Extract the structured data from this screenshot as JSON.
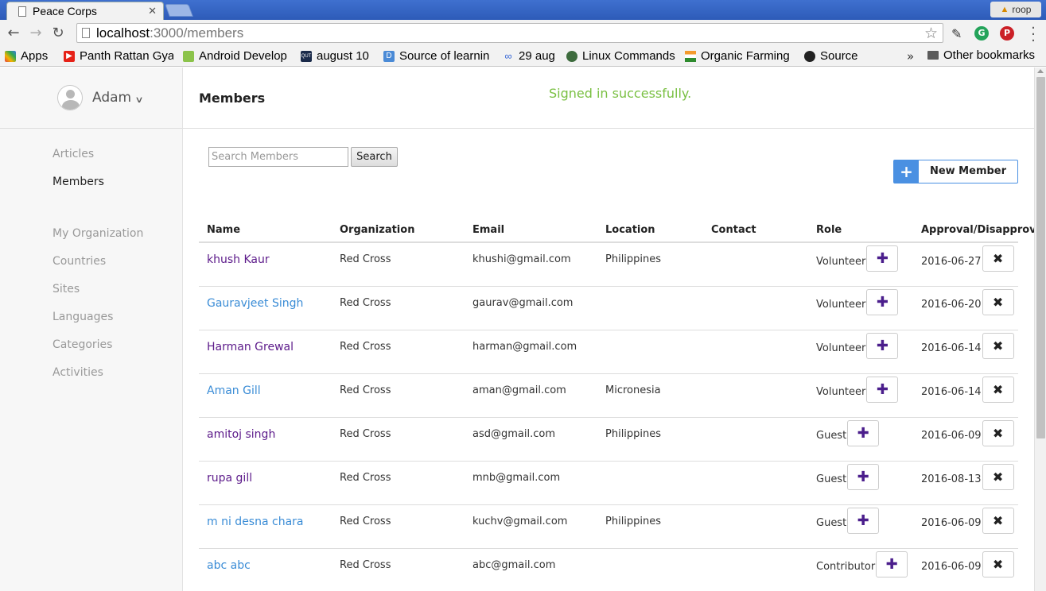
{
  "browser": {
    "tab_title": "Peace Corps",
    "profile_name": "roop",
    "url_host": "localhost",
    "url_path": ":3000/members",
    "bookmarks": [
      {
        "label": "Apps",
        "icon_color": "#e04040"
      },
      {
        "label": "Panth Rattan Gya",
        "icon_color": "#e62117"
      },
      {
        "label": "Android Develop",
        "icon_color": "#8bc34a"
      },
      {
        "label": "august 10",
        "icon_color": "#1a2a4a"
      },
      {
        "label": "Source of learnin",
        "icon_color": "#4a8ad6"
      },
      {
        "label": "29 aug",
        "icon_color": "#3b6ad6"
      },
      {
        "label": "Linux Commands",
        "icon_color": "#3d6b3d"
      },
      {
        "label": "Organic Farming",
        "icon_color": "#f39a2d"
      },
      {
        "label": "Source",
        "icon_color": "#222222"
      }
    ],
    "bookmarks_overflow": "»",
    "other_bookmarks": "Other bookmarks"
  },
  "sidebar": {
    "user_name": "Adam",
    "items": [
      {
        "label": "Articles",
        "active": false
      },
      {
        "label": "Members",
        "active": true
      },
      {
        "label": "My Organization",
        "active": false
      },
      {
        "label": "Countries",
        "active": false
      },
      {
        "label": "Sites",
        "active": false
      },
      {
        "label": "Languages",
        "active": false
      },
      {
        "label": "Categories",
        "active": false
      },
      {
        "label": "Activities",
        "active": false
      }
    ]
  },
  "header": {
    "title": "Members",
    "flash": "Signed in successfully."
  },
  "search": {
    "placeholder": "Search Members",
    "button_label": "Search"
  },
  "new_member": {
    "icon": "+",
    "label": "New Member"
  },
  "table": {
    "columns": [
      "Name",
      "Organization",
      "Email",
      "Location",
      "Contact",
      "Role",
      "Approval/Disapproval"
    ],
    "rows": [
      {
        "name": "khush Kaur",
        "visited": true,
        "organization": "Red Cross",
        "email": "khushi@gmail.com",
        "location": "Philippines",
        "contact": "",
        "role": "Volunteer",
        "date": "2016-06-27"
      },
      {
        "name": "Gauravjeet Singh",
        "visited": false,
        "organization": "Red Cross",
        "email": "gaurav@gmail.com",
        "location": "",
        "contact": "",
        "role": "Volunteer",
        "date": "2016-06-20"
      },
      {
        "name": "Harman Grewal",
        "visited": true,
        "organization": "Red Cross",
        "email": "harman@gmail.com",
        "location": "",
        "contact": "",
        "role": "Volunteer",
        "date": "2016-06-14"
      },
      {
        "name": "Aman Gill",
        "visited": false,
        "organization": "Red Cross",
        "email": "aman@gmail.com",
        "location": "Micronesia",
        "contact": "",
        "role": "Volunteer",
        "date": "2016-06-14"
      },
      {
        "name": "amitoj singh",
        "visited": true,
        "organization": "Red Cross",
        "email": "asd@gmail.com",
        "location": "Philippines",
        "contact": "",
        "role": "Guest",
        "date": "2016-06-09"
      },
      {
        "name": "rupa gill",
        "visited": true,
        "organization": "Red Cross",
        "email": "mnb@gmail.com",
        "location": "",
        "contact": "",
        "role": "Guest",
        "date": "2016-08-13"
      },
      {
        "name": "m ni desna chara",
        "visited": false,
        "organization": "Red Cross",
        "email": "kuchv@gmail.com",
        "location": "Philippines",
        "contact": "",
        "role": "Guest",
        "date": "2016-06-09"
      },
      {
        "name": "abc abc",
        "visited": false,
        "organization": "Red Cross",
        "email": "abc@gmail.com",
        "location": "",
        "contact": "",
        "role": "Contributor",
        "date": "2016-06-09"
      }
    ]
  },
  "colors": {
    "accent_blue": "#4a90e2",
    "flash_green": "#7ac043",
    "visited_link": "#5c1a8a",
    "link": "#3a8cd6",
    "role_plus": "#4b1e8c"
  }
}
